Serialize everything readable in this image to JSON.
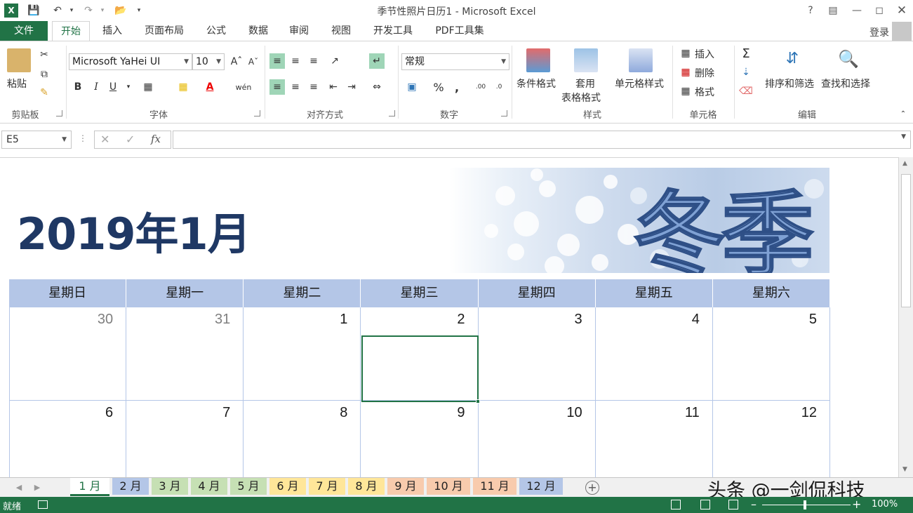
{
  "app": {
    "title": "季节性照片日历1 - Microsoft Excel",
    "help": "?",
    "login": "登录"
  },
  "ribbon_tabs": [
    "文件",
    "开始",
    "插入",
    "页面布局",
    "公式",
    "数据",
    "审阅",
    "视图",
    "开发工具",
    "PDF工具集"
  ],
  "ribbon": {
    "clipboard": {
      "paste": "粘贴",
      "group": "剪贴板"
    },
    "font": {
      "name": "Microsoft YaHei UI",
      "size": "10",
      "group": "字体",
      "bold": "B",
      "italic": "I",
      "underline": "U"
    },
    "alignment": {
      "group": "对齐方式"
    },
    "number": {
      "format": "常规",
      "group": "数字",
      "percent": "%",
      "comma": ","
    },
    "styles": {
      "conditional": "条件格式",
      "table_line1": "套用",
      "table_line2": "表格格式",
      "cell_styles": "单元格样式",
      "group": "样式"
    },
    "cells": {
      "insert": "插入",
      "delete": "删除",
      "format": "格式",
      "group": "单元格"
    },
    "editing": {
      "sort": "排序和筛选",
      "find": "查找和选择",
      "group": "编辑",
      "sum": "Σ"
    }
  },
  "formula_bar": {
    "name_box": "E5",
    "fx": "fx",
    "formula": ""
  },
  "calendar": {
    "title": "2019年1月",
    "banner_word": "冬季",
    "day_names": [
      "星期日",
      "星期一",
      "星期二",
      "星期三",
      "星期四",
      "星期五",
      "星期六"
    ],
    "weeks": [
      [
        "30",
        "31",
        "1",
        "2",
        "3",
        "4",
        "5"
      ],
      [
        "6",
        "7",
        "8",
        "9",
        "10",
        "11",
        "12"
      ]
    ],
    "dim_days": [
      "30",
      "31"
    ]
  },
  "sheet_tabs": [
    {
      "label": "1 月",
      "color": "#ffffff",
      "active": true
    },
    {
      "label": "2 月",
      "color": "#b4c6e7"
    },
    {
      "label": "3 月",
      "color": "#c6e0b4"
    },
    {
      "label": "4 月",
      "color": "#c6e0b4"
    },
    {
      "label": "5 月",
      "color": "#c6e0b4"
    },
    {
      "label": "6 月",
      "color": "#ffe699"
    },
    {
      "label": "7 月",
      "color": "#ffe699"
    },
    {
      "label": "8 月",
      "color": "#ffe699"
    },
    {
      "label": "9 月",
      "color": "#f8cbad"
    },
    {
      "label": "10 月",
      "color": "#f8cbad"
    },
    {
      "label": "11 月",
      "color": "#f8cbad"
    },
    {
      "label": "12 月",
      "color": "#b4c6e7"
    }
  ],
  "watermark": "头条 @一剑侃科技",
  "status": {
    "ready": "就绪",
    "zoom": "100%"
  },
  "colors": {
    "excel_green": "#217346",
    "header_blue": "#b4c6e7",
    "title_navy": "#1f3864"
  }
}
